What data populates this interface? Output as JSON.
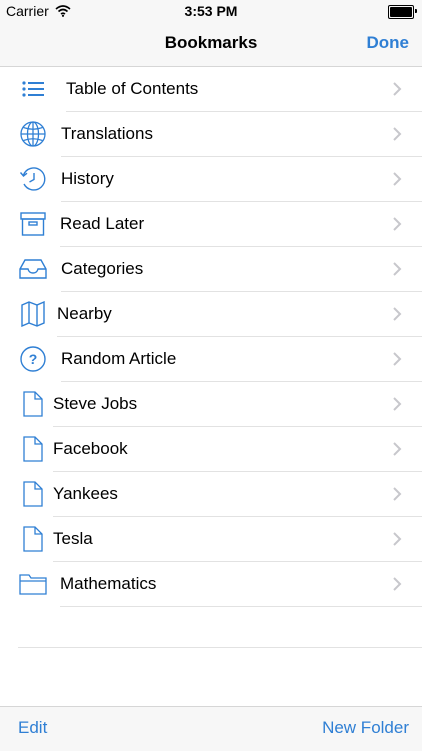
{
  "status_bar": {
    "carrier": "Carrier",
    "time": "3:53 PM"
  },
  "nav": {
    "title": "Bookmarks",
    "done": "Done"
  },
  "items": [
    {
      "label": "Table of Contents",
      "icon": "list-icon"
    },
    {
      "label": "Translations",
      "icon": "globe-icon"
    },
    {
      "label": "History",
      "icon": "history-clock-icon"
    },
    {
      "label": "Read Later",
      "icon": "archive-box-icon"
    },
    {
      "label": "Categories",
      "icon": "inbox-tray-icon"
    },
    {
      "label": "Nearby",
      "icon": "map-icon"
    },
    {
      "label": "Random Article",
      "icon": "question-circle-icon"
    },
    {
      "label": "Steve Jobs",
      "icon": "document-icon"
    },
    {
      "label": "Facebook",
      "icon": "document-icon"
    },
    {
      "label": "Yankees",
      "icon": "document-icon"
    },
    {
      "label": "Tesla",
      "icon": "document-icon"
    },
    {
      "label": "Mathematics",
      "icon": "folder-icon"
    }
  ],
  "toolbar": {
    "edit": "Edit",
    "new_folder": "New Folder"
  },
  "colors": {
    "accent": "#2f7fd4",
    "separator": "#e2e2e2",
    "chevron": "#c7c7cc"
  }
}
